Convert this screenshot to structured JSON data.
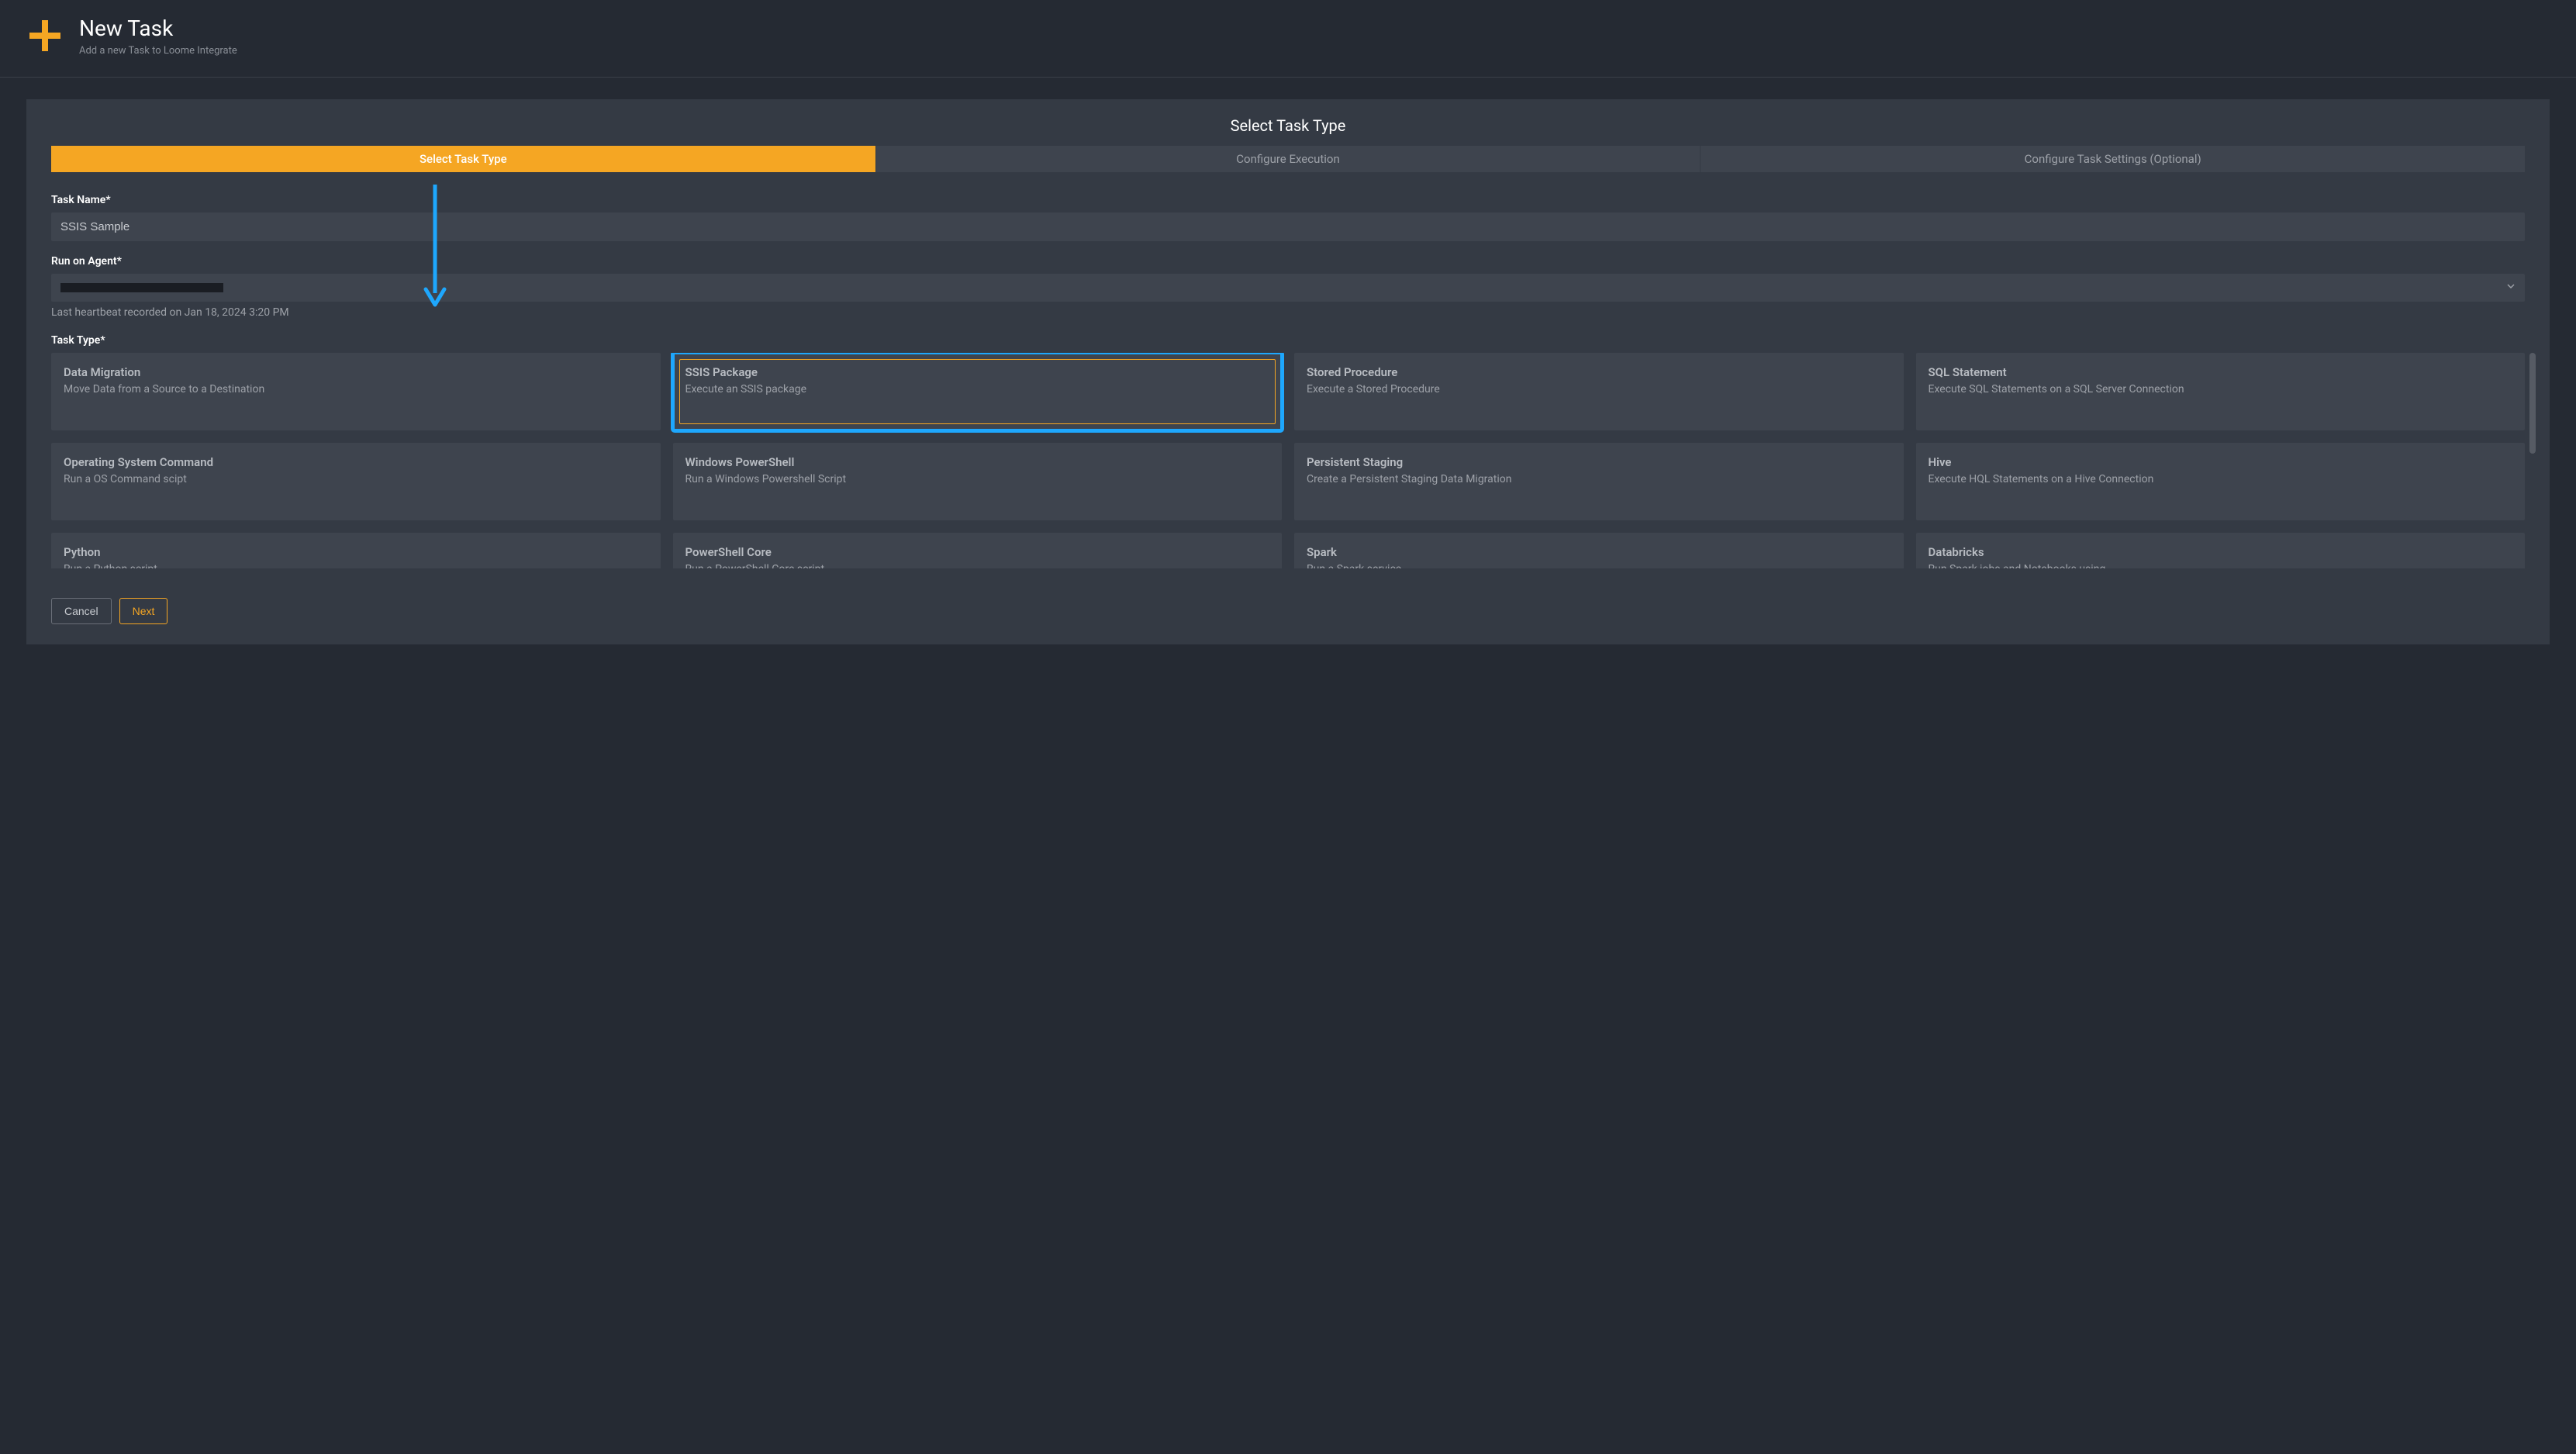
{
  "header": {
    "title": "New Task",
    "subtitle": "Add a new Task to Loome Integrate"
  },
  "section_title": "Select Task Type",
  "steps": [
    {
      "label": "Select Task Type",
      "active": true
    },
    {
      "label": "Configure Execution",
      "active": false
    },
    {
      "label": "Configure Task Settings (Optional)",
      "active": false
    }
  ],
  "form": {
    "task_name_label": "Task Name*",
    "task_name_value": "SSIS Sample",
    "agent_label": "Run on Agent*",
    "agent_selected": "",
    "agent_helper": "Last heartbeat recorded on Jan 18, 2024 3:20 PM",
    "task_type_label": "Task Type*"
  },
  "task_types": [
    {
      "title": "Data Migration",
      "desc": "Move Data from a Source to a Destination",
      "selected": false
    },
    {
      "title": "SSIS Package",
      "desc": "Execute an SSIS package",
      "selected": true
    },
    {
      "title": "Stored Procedure",
      "desc": "Execute a Stored Procedure",
      "selected": false
    },
    {
      "title": "SQL Statement",
      "desc": "Execute SQL Statements on a SQL Server Connection",
      "selected": false
    },
    {
      "title": "Operating System Command",
      "desc": "Run a OS Command scipt",
      "selected": false
    },
    {
      "title": "Windows PowerShell",
      "desc": "Run a Windows Powershell Script",
      "selected": false
    },
    {
      "title": "Persistent Staging",
      "desc": "Create a Persistent Staging Data Migration",
      "selected": false
    },
    {
      "title": "Hive",
      "desc": "Execute HQL Statements on a Hive Connection",
      "selected": false
    },
    {
      "title": "Python",
      "desc": "Run a Python script",
      "selected": false
    },
    {
      "title": "PowerShell Core",
      "desc": "Run a PowerShell Core script",
      "selected": false
    },
    {
      "title": "Spark",
      "desc": "Run a Spark service",
      "selected": false
    },
    {
      "title": "Databricks",
      "desc": "Run Spark jobs and Notebooks using",
      "selected": false
    }
  ],
  "buttons": {
    "cancel": "Cancel",
    "next": "Next"
  },
  "colors": {
    "accent_orange": "#f5a623",
    "highlight_blue": "#1ea7fd",
    "bg_dark": "#252a33",
    "card_bg": "#343a44",
    "tile_bg": "#3e444e"
  }
}
